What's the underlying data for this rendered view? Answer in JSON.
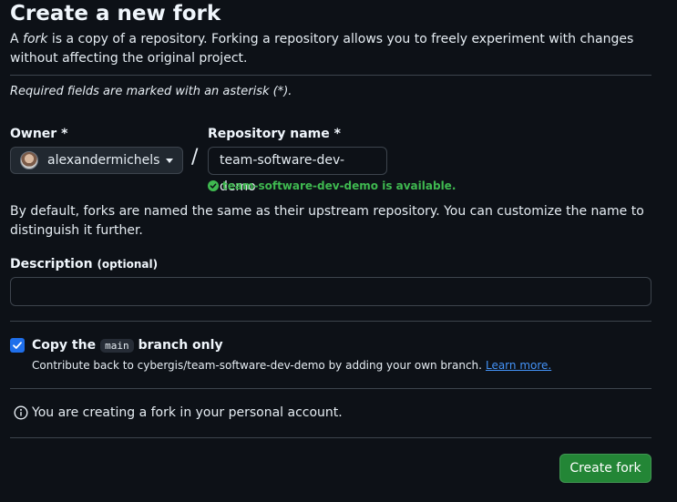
{
  "page": {
    "title": "Create a new fork",
    "intro_prefix": "A ",
    "intro_em": "fork",
    "intro_rest": " is a copy of a repository. Forking a repository allows you to freely experiment with changes without affecting the original project.",
    "required_note": "Required fields are marked with an asterisk (*)."
  },
  "owner": {
    "label": "Owner *",
    "value": "alexandermichels"
  },
  "separator": "/",
  "repo": {
    "label": "Repository name *",
    "value": "team-software-dev-demo",
    "availability": "team-software-dev-demo is available."
  },
  "default_note": "By default, forks are named the same as their upstream repository. You can customize the name to distinguish it further.",
  "description": {
    "label": "Description",
    "optional": "(optional)",
    "value": ""
  },
  "copy_branch": {
    "checked": true,
    "title_prefix": "Copy the",
    "branch": "main",
    "title_suffix": "branch only",
    "subtext": "Contribute back to cybergis/team-software-dev-demo by adding your own branch.",
    "link": "Learn more."
  },
  "info_note": "You are creating a fork in your personal account.",
  "actions": {
    "create_label": "Create fork"
  },
  "colors": {
    "background": "#0d1117",
    "success": "#3fb950",
    "primary_button": "#238636",
    "link": "#4493f8",
    "checkbox": "#1f6feb"
  }
}
